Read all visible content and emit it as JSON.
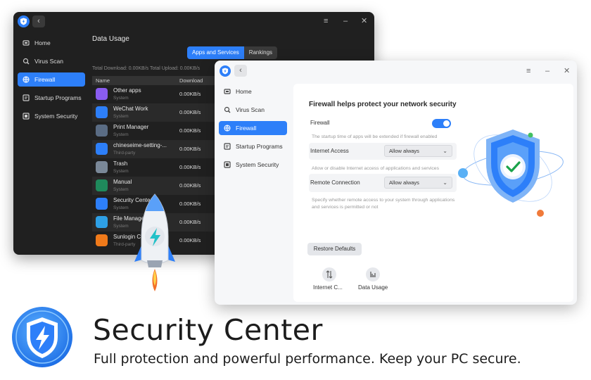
{
  "dark_window": {
    "sidebar": [
      "Home",
      "Virus Scan",
      "Firewall",
      "Startup Programs",
      "System Security"
    ],
    "active_index": 2,
    "title": "Data Usage",
    "tabs": [
      "Apps and Services",
      "Rankings"
    ],
    "stats": "Total Download: 0.00KB/s  Total Upload: 0.00KB/s",
    "columns": [
      "Name",
      "Download"
    ],
    "rows": [
      {
        "name": "Other apps",
        "sub": "System",
        "download": "0.00KB/s",
        "color": "#8a5cf0"
      },
      {
        "name": "WeChat Work",
        "sub": "System",
        "download": "0.00KB/s",
        "color": "#2d7ff9"
      },
      {
        "name": "Print Manager",
        "sub": "System",
        "download": "0.00KB/s",
        "color": "#5a6c84"
      },
      {
        "name": "chineseime-setting-...",
        "sub": "Third-party",
        "download": "0.00KB/s",
        "color": "#2d7ff9"
      },
      {
        "name": "Trash",
        "sub": "System",
        "download": "0.00KB/s",
        "color": "#7a8898"
      },
      {
        "name": "Manual",
        "sub": "System",
        "download": "0.00KB/s",
        "color": "#1f8a5c"
      },
      {
        "name": "Security Center",
        "sub": "System",
        "download": "0.00KB/s",
        "color": "#2d7ff9"
      },
      {
        "name": "File Manager",
        "sub": "System",
        "download": "0.00KB/s",
        "color": "#2ea0e6"
      },
      {
        "name": "Sunlogin Client",
        "sub": "Third-party",
        "download": "0.00KB/s",
        "color": "#f07a1a"
      }
    ]
  },
  "light_window": {
    "sidebar": [
      "Home",
      "Virus Scan",
      "Firewall",
      "Startup Programs",
      "System Security"
    ],
    "active_index": 2,
    "title": "Firewall helps protect your network security",
    "firewall_label": "Firewall",
    "firewall_on": true,
    "firewall_note": "The startup time of apps will be extended if firewall enabled",
    "internet_access_label": "Internet Access",
    "internet_access_value": "Allow always",
    "internet_access_note": "Allow or disable Internet access of applications and services",
    "remote_label": "Remote Connection",
    "remote_value": "Allow always",
    "remote_note": "Specify whether remote access to your system through applications and services is permitted or not",
    "restore_button": "Restore Defaults",
    "shortcuts": [
      "Internet C...",
      "Data Usage"
    ]
  },
  "banner": {
    "title": "Security Center",
    "subtitle": "Full protection and powerful performance. Keep your PC secure."
  },
  "colors": {
    "accent": "#2d7ff9",
    "dark_bg": "#202020",
    "light_bg": "#f6f7f9"
  }
}
